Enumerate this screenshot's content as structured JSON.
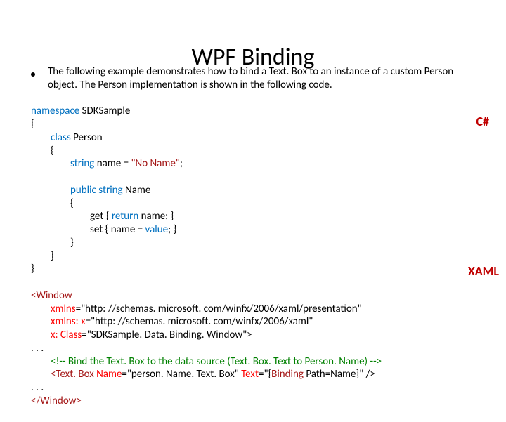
{
  "title": "WPF Binding",
  "bullet": "The following example demonstrates how to bind a Text. Box to an instance of a custom Person object. The Person implementation is shown in the following code.",
  "badge_cs": "C#",
  "badge_xaml": "XAML",
  "cs": {
    "l1a": "namespace",
    "l1b": " SDKSample",
    "l2": "{",
    "l3a": "class",
    "l3b": " Person",
    "l4": "{",
    "l5a": "string",
    "l5b": " name = ",
    "l5c": "\"No Name\"",
    "l5d": ";",
    "l6a": "public",
    "l6b": " ",
    "l6c": "string",
    "l6d": " Name",
    "l7": "{",
    "l8a": "get { ",
    "l8b": "return",
    "l8c": " name; }",
    "l9a": "set { name = ",
    "l9b": "value",
    "l9c": "; }",
    "l10": "}",
    "l11": "}",
    "l12": "}"
  },
  "xaml": {
    "l1": "<Window",
    "l2a": "xmlns",
    "l2b": "=\"http: //schemas. microsoft. com/winfx/2006/xaml/presentation\"",
    "l3a": "xmlns: x",
    "l3b": "=\"http: //schemas. microsoft. com/winfx/2006/xaml\"",
    "l4a": "x: Class",
    "l4b": "=\"SDKSample. Data. Binding. Window\">",
    "l5": ". . .",
    "l6": "<!-- Bind the Text. Box to the data source (Text. Box. Text to Person. Name) -->",
    "l7a": "<Text. Box ",
    "l7b": "Name",
    "l7c": "=\"person. Name. Text. Box\" ",
    "l7d": "Text",
    "l7e": "=\"{",
    "l7f": "Binding",
    "l7g": " Path=Name}\" />",
    "l8": ". . .",
    "l9": "</Window>"
  }
}
